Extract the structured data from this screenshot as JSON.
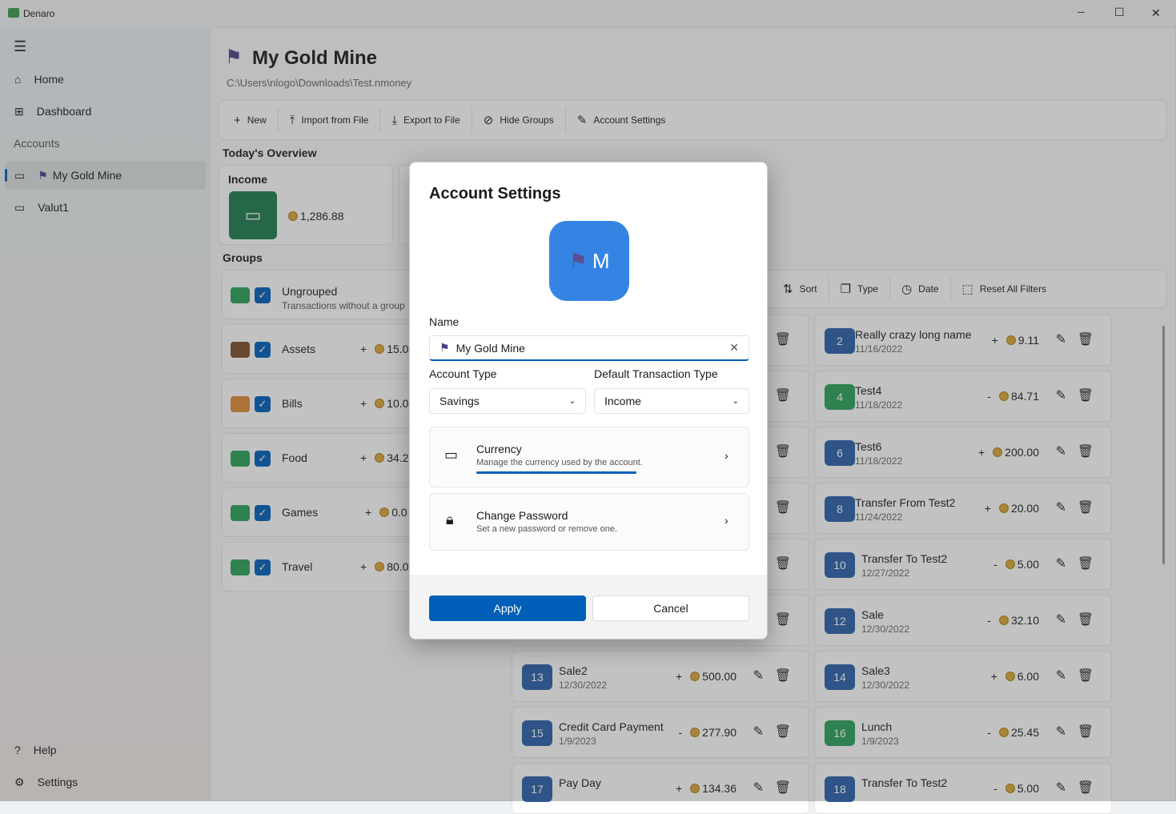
{
  "window": {
    "title": "Denaro",
    "minimize": "─",
    "maximize": "☐",
    "close": "✕"
  },
  "sidebar": {
    "menu": "☰",
    "items": [
      {
        "icon": "⌂",
        "label": "Home"
      },
      {
        "icon": "⊞",
        "label": "Dashboard"
      }
    ],
    "section": "Accounts",
    "accounts": [
      {
        "icon": "▭",
        "label": "My Gold Mine",
        "flag": "⚑"
      },
      {
        "icon": "▭",
        "label": "Valut1"
      }
    ],
    "footer": [
      {
        "icon": "?",
        "label": "Help"
      },
      {
        "icon": "⚙",
        "label": "Settings"
      }
    ]
  },
  "header": {
    "title": "My Gold Mine",
    "path": "C:\\Users\\nlogo\\Downloads\\Test.nmoney"
  },
  "toolbar": [
    {
      "icon": "+",
      "label": "New"
    },
    {
      "icon": "⤒",
      "label": "Import from File"
    },
    {
      "icon": "⤓",
      "label": "Export to File"
    },
    {
      "icon": "⊘",
      "label": "Hide Groups"
    },
    {
      "icon": "✎",
      "label": "Account Settings"
    }
  ],
  "overview": {
    "title": "Today's Overview",
    "income_label": "Income",
    "income_value": "1,286.88",
    "income_color": "#1e7a50"
  },
  "groups": {
    "title": "Groups",
    "items": [
      {
        "name": "Ungrouped",
        "desc": "Transactions without a group",
        "color": "#2aa05a"
      },
      {
        "name": "Assets",
        "sign": "+",
        "amount": "15.0",
        "color": "#7a4f2f"
      },
      {
        "name": "Bills",
        "sign": "+",
        "amount": "10.0",
        "color": "#e08a3c"
      },
      {
        "name": "Food",
        "sign": "+",
        "amount": "34.2",
        "color": "#2aa05a"
      },
      {
        "name": "Games",
        "sign": "+",
        "amount": "0.0",
        "color": "#2aa05a"
      },
      {
        "name": "Travel",
        "sign": "+",
        "amount": "80.0",
        "color": "#2aa05a"
      }
    ]
  },
  "filters": [
    {
      "icon": "⇅",
      "label": "Sort"
    },
    {
      "icon": "❐",
      "label": "Type"
    },
    {
      "icon": "◷",
      "label": "Date"
    },
    {
      "icon": "⬚",
      "label": "Reset All Filters"
    }
  ],
  "transactions": {
    "left": [
      {
        "id": "13",
        "name": "Sale2",
        "date": "12/30/2022",
        "sign": "+",
        "amount": "500.00",
        "color": "#2a5fa8"
      },
      {
        "id": "15",
        "name": "Credit Card Payment",
        "date": "1/9/2023",
        "sign": "-",
        "amount": "277.90",
        "color": "#2a5fa8"
      },
      {
        "id": "17",
        "name": "Pay Day",
        "date": "",
        "sign": "+",
        "amount": "134.36",
        "color": "#2a5fa8"
      }
    ],
    "right": [
      {
        "id": "2",
        "name": "Really crazy long name",
        "date": "11/16/2022",
        "sign": "+",
        "amount": "9.11",
        "color": "#2a5fa8"
      },
      {
        "id": "4",
        "name": "Test4",
        "date": "11/18/2022",
        "sign": "-",
        "amount": "84.71",
        "color": "#2aa05a"
      },
      {
        "id": "6",
        "name": "Test6",
        "date": "11/18/2022",
        "sign": "+",
        "amount": "200.00",
        "color": "#2a5fa8"
      },
      {
        "id": "8",
        "name": "Transfer From Test2",
        "date": "11/24/2022",
        "sign": "+",
        "amount": "20.00",
        "color": "#2a5fa8"
      },
      {
        "id": "10",
        "name": "Transfer To Test2",
        "date": "12/27/2022",
        "sign": "-",
        "amount": "5.00",
        "color": "#2a5fa8"
      },
      {
        "id": "12",
        "name": "Sale",
        "date": "12/30/2022",
        "sign": "-",
        "amount": "32.10",
        "color": "#2a5fa8"
      },
      {
        "id": "14",
        "name": "Sale3",
        "date": "12/30/2022",
        "sign": "+",
        "amount": "6.00",
        "color": "#2a5fa8"
      },
      {
        "id": "16",
        "name": "Lunch",
        "date": "1/9/2023",
        "sign": "-",
        "amount": "25.45",
        "color": "#2aa05a"
      },
      {
        "id": "18",
        "name": "Transfer To Test2",
        "date": "",
        "sign": "-",
        "amount": "5.00",
        "color": "#2a5fa8"
      }
    ]
  },
  "dialog": {
    "title": "Account Settings",
    "avatar_letter": "M",
    "avatar_color": "#3584e4",
    "name_label": "Name",
    "name_value": "My Gold Mine",
    "type_label": "Account Type",
    "type_value": "Savings",
    "default_label": "Default Transaction Type",
    "default_value": "Income",
    "currency_title": "Currency",
    "currency_desc": "Manage the currency used by the account.",
    "password_title": "Change Password",
    "password_desc": "Set a new password or remove one.",
    "apply": "Apply",
    "cancel": "Cancel",
    "accent": "#005fb8"
  }
}
